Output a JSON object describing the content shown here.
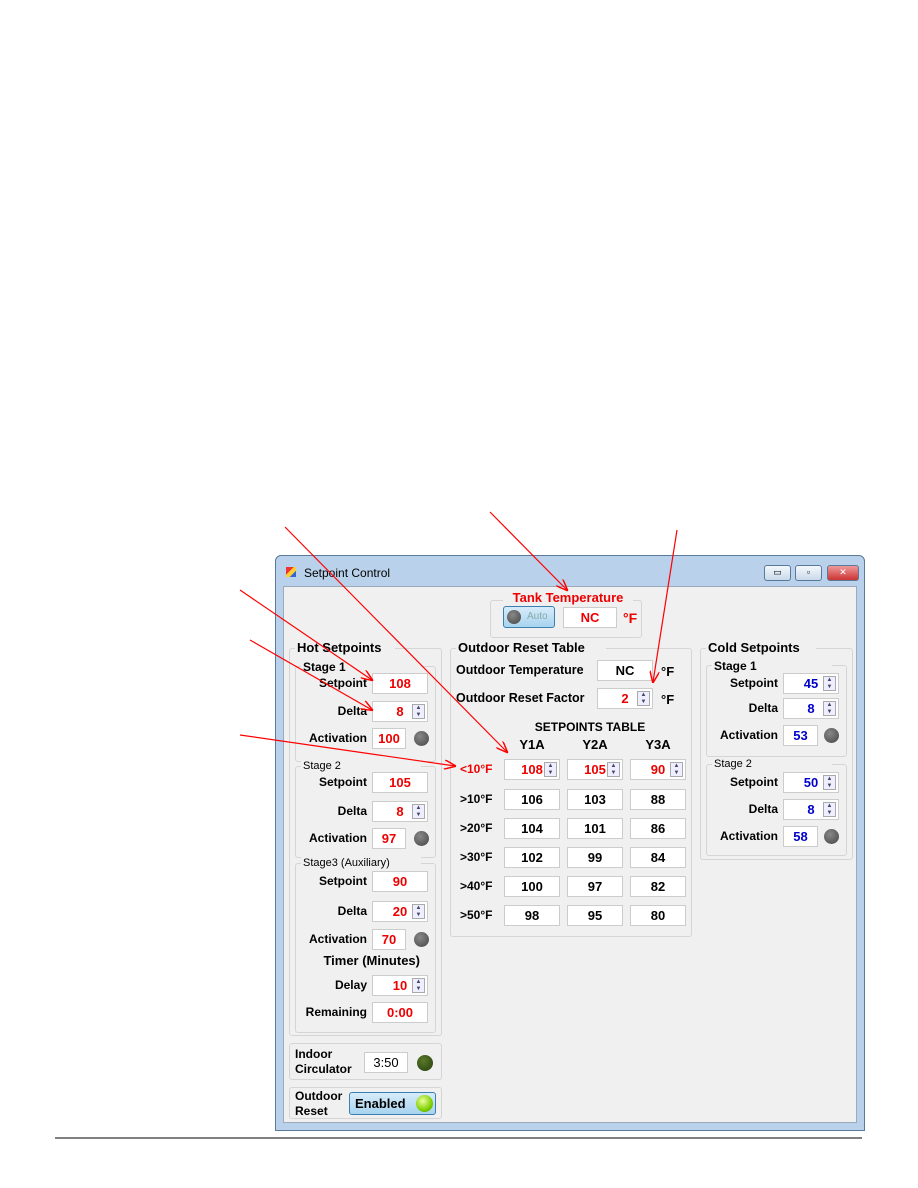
{
  "window": {
    "title": "Setpoint Control",
    "minimize": "▭",
    "maximize": "▫",
    "close": "✕"
  },
  "tank": {
    "title": "Tank Temperature",
    "auto_label": "Auto",
    "value": "NC",
    "unit": "°F"
  },
  "hot": {
    "title": "Hot Setpoints",
    "stage1": {
      "title": "Stage 1",
      "setpoint": "108",
      "delta": "8",
      "activation": "100"
    },
    "stage2": {
      "title": "Stage 2",
      "setpoint": "105",
      "delta": "8",
      "activation": "97"
    },
    "stage3": {
      "title": "Stage3 (Auxiliary)",
      "setpoint": "90",
      "delta": "20",
      "activation": "70",
      "timer_title": "Timer (Minutes)",
      "delay": "10",
      "remaining": "0:00"
    }
  },
  "labels": {
    "setpoint": "Setpoint",
    "delta": "Delta",
    "activation": "Activation",
    "delay": "Delay",
    "remaining": "Remaining"
  },
  "indoor": {
    "label_line1": "Indoor",
    "label_line2": "Circulator",
    "value": "3:50"
  },
  "outdoor": {
    "label_line1": "Outdoor",
    "label_line2": "Reset",
    "button": "Enabled"
  },
  "reset_table": {
    "title": "Outdoor Reset Table",
    "outdoor_temp_label": "Outdoor Temperature",
    "outdoor_temp": "NC",
    "factor_label": "Outdoor Reset Factor",
    "factor": "2",
    "unit": "°F",
    "table_title": "SETPOINTS TABLE",
    "columns": [
      "Y1A",
      "Y2A",
      "Y3A"
    ],
    "rows": [
      {
        "label": "<10°F",
        "values": [
          "108",
          "105",
          "90"
        ]
      },
      {
        "label": ">10°F",
        "values": [
          "106",
          "103",
          "88"
        ]
      },
      {
        "label": ">20°F",
        "values": [
          "104",
          "101",
          "86"
        ]
      },
      {
        "label": ">30°F",
        "values": [
          "102",
          "99",
          "84"
        ]
      },
      {
        "label": ">40°F",
        "values": [
          "100",
          "97",
          "82"
        ]
      },
      {
        "label": ">50°F",
        "values": [
          "98",
          "95",
          "80"
        ]
      }
    ]
  },
  "cold": {
    "title": "Cold Setpoints",
    "stage1": {
      "title": "Stage 1",
      "setpoint": "45",
      "delta": "8",
      "activation": "53"
    },
    "stage2": {
      "title": "Stage 2",
      "setpoint": "50",
      "delta": "8",
      "activation": "58"
    }
  },
  "colors": {
    "hot": "#e00000",
    "cold": "#0000cc",
    "annotation": "#ff0000"
  }
}
